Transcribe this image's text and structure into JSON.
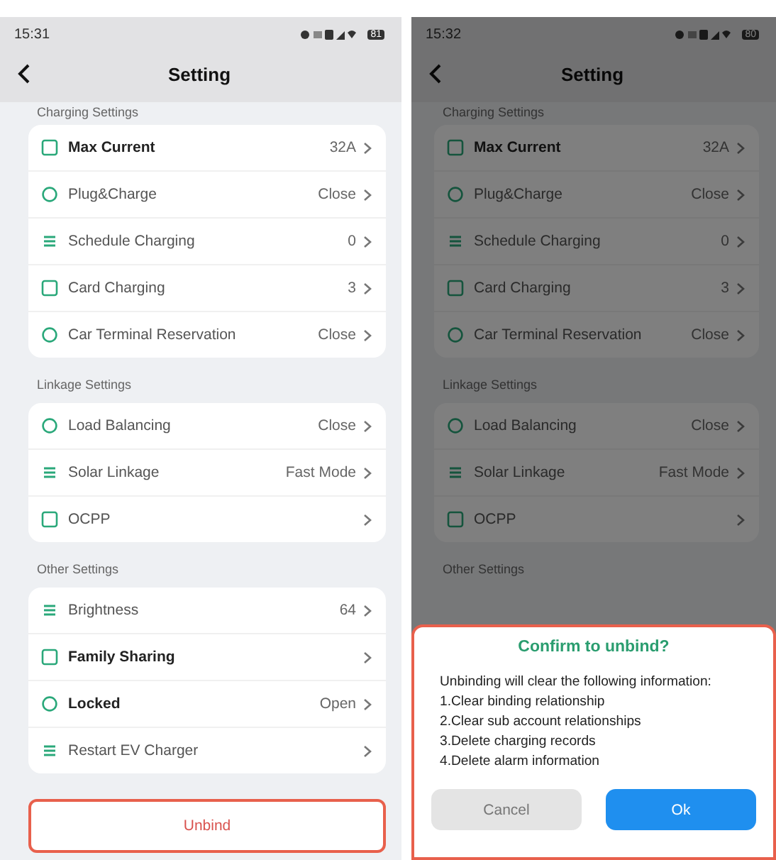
{
  "screens": [
    {
      "dimmed": false,
      "status_bar": {
        "time": "15:31",
        "battery": "81"
      },
      "title": "Setting",
      "sections": [
        {
          "header": "Charging Settings",
          "items": [
            {
              "label": "Max Current",
              "value": "32A",
              "emphasized": true
            },
            {
              "label": "Plug&Charge",
              "value": "Close",
              "emphasized": false
            },
            {
              "label": "Schedule Charging",
              "value": "0",
              "emphasized": false
            },
            {
              "label": "Card Charging",
              "value": "3",
              "emphasized": false
            },
            {
              "label": "Car Terminal Reservation",
              "value": "Close",
              "emphasized": false
            }
          ]
        },
        {
          "header": "Linkage Settings",
          "items": [
            {
              "label": "Load Balancing",
              "value": "Close",
              "emphasized": false
            },
            {
              "label": "Solar Linkage",
              "value": "Fast Mode",
              "emphasized": false
            },
            {
              "label": "OCPP",
              "emphasized": false
            }
          ]
        },
        {
          "header": "Other Settings",
          "items": [
            {
              "label": "Brightness",
              "value": "64",
              "emphasized": false
            },
            {
              "label": "Family Sharing",
              "emphasized": true
            },
            {
              "label": "Locked",
              "value": "Open",
              "emphasized": true
            },
            {
              "label": "Restart EV Charger",
              "emphasized": false
            }
          ]
        }
      ],
      "unbind_button": {
        "label": "Unbind",
        "highlighted": true
      }
    },
    {
      "dimmed": true,
      "status_bar": {
        "time": "15:32",
        "battery": "80"
      },
      "title": "Setting",
      "sections": [
        {
          "header": "Charging Settings",
          "items": [
            {
              "label": "Max Current",
              "value": "32A",
              "emphasized": true
            },
            {
              "label": "Plug&Charge",
              "value": "Close",
              "emphasized": false
            },
            {
              "label": "Schedule Charging",
              "value": "0",
              "emphasized": false
            },
            {
              "label": "Card Charging",
              "value": "3",
              "emphasized": false
            },
            {
              "label": "Car Terminal Reservation",
              "value": "Close",
              "emphasized": false
            }
          ]
        },
        {
          "header": "Linkage Settings",
          "items": [
            {
              "label": "Load Balancing",
              "value": "Close",
              "emphasized": false
            },
            {
              "label": "Solar Linkage",
              "value": "Fast Mode",
              "emphasized": false
            },
            {
              "label": "OCPP",
              "emphasized": false
            }
          ]
        },
        {
          "header": "Other Settings"
        }
      ],
      "dialog": {
        "title": "Confirm to unbind?",
        "highlighted": true,
        "message": [
          "Unbinding will clear the following information:",
          "1.Clear binding relationship",
          "2.Clear sub account relationships",
          "3.Delete charging records",
          "4.Delete alarm information"
        ],
        "buttons": [
          {
            "label": "Cancel",
            "kind": "secondary"
          },
          {
            "label": "Ok",
            "kind": "primary"
          }
        ]
      }
    }
  ]
}
